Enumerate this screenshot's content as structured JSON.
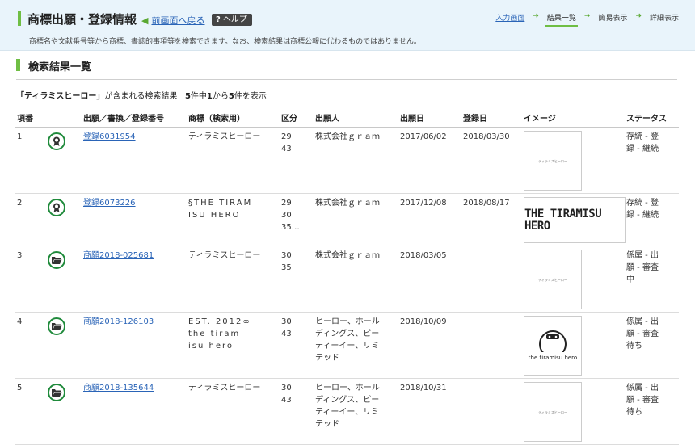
{
  "header": {
    "title": "商標出願・登録情報",
    "back_label": "前画面へ戻る",
    "help_label": "ヘルプ",
    "help_icon_char": "?",
    "subtitle": "商標名や文献番号等から商標、書誌的事項等を検索できます。なお、検索結果は商標公報に代わるものではありません。",
    "steps": [
      {
        "label": "入力画面"
      },
      {
        "label": "結果一覧"
      },
      {
        "label": "簡易表示"
      },
      {
        "label": "詳細表示"
      }
    ]
  },
  "section_title": "検索結果一覧",
  "summary": {
    "query": "「ティラミスヒーロー」",
    "mid": "が含まれる検索結果",
    "total": "5",
    "range_a": "件中",
    "start": "1",
    "range_b": "から",
    "end": "5",
    "range_c": "件を表示"
  },
  "columns": [
    "項番",
    "",
    "出願／書換／登録番号",
    "商標（検索用）",
    "区分",
    "出願人",
    "出願日",
    "登録日",
    "イメージ",
    "ステータス"
  ],
  "rows": [
    {
      "no": "1",
      "icon": "registered-ribbon-icon",
      "number": "登録6031954",
      "mark": "ティラミスヒーロー",
      "classes": "29\n43",
      "applicant": "株式会社ｇｒａｍ",
      "filed": "2017/06/02",
      "registered": "2018/03/30",
      "image": "ティラミスヒーロー",
      "status": "存続 - 登\n録 - 継続"
    },
    {
      "no": "2",
      "icon": "registered-ribbon-icon",
      "number": "登録6073226",
      "mark": "§THE TIRAM\nISU HERO",
      "classes": "29\n30\n35…",
      "applicant": "株式会社ｇｒａｍ",
      "filed": "2017/12/08",
      "registered": "2018/08/17",
      "image": "THE TIRAMISU HERO",
      "status": "存続 - 登\n録 - 継続"
    },
    {
      "no": "3",
      "icon": "folder-open-icon",
      "number": "商願2018-025681",
      "mark": "ティラミスヒーロー",
      "classes": "30\n35",
      "applicant": "株式会社ｇｒａｍ",
      "filed": "2018/03/05",
      "registered": "",
      "image": "ティラミスヒーロー",
      "status": "係属 - 出\n願 - 審査\n中"
    },
    {
      "no": "4",
      "icon": "folder-open-icon",
      "number": "商願2018-126103",
      "mark": "EST. 2012∞\nthe tiram\nisu hero",
      "classes": "30\n43",
      "applicant": "ヒーロー、ホール\nディングス、ピー\nティーイー、リミ\nテッド",
      "filed": "2018/10/09",
      "registered": "",
      "image": "the tiramisu hero",
      "status": "係属 - 出\n願 - 審査\n待ち"
    },
    {
      "no": "5",
      "icon": "folder-open-icon",
      "number": "商願2018-135644",
      "mark": "ティラミスヒーロー",
      "classes": "30\n43",
      "applicant": "ヒーロー、ホール\nディングス、ピー\nティーイー、リミ\nテッド",
      "filed": "2018/10/31",
      "registered": "",
      "image": "ティラミスヒーロー",
      "status": "係属 - 出\n願 - 審査\n待ち"
    }
  ]
}
